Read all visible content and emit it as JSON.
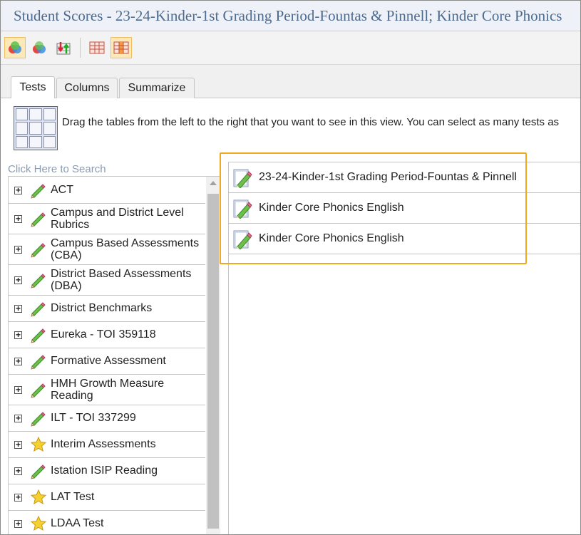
{
  "window": {
    "title": "Student Scores - 23-24-Kinder-1st Grading Period-Fountas & Pinnell; Kinder Core Phonics"
  },
  "toolbar": {
    "buttons": [
      "venn-icon",
      "venn-alt-icon",
      "sort-icon",
      "table-icon",
      "table-columns-icon"
    ]
  },
  "tabs": [
    {
      "label": "Tests",
      "active": true
    },
    {
      "label": "Columns",
      "active": false
    },
    {
      "label": "Summarize",
      "active": false
    }
  ],
  "instructions": "Drag the tables from the left to the right that you want to see in this view. You can select as many tests as",
  "search": {
    "placeholder": "Click Here to Search"
  },
  "tree": [
    {
      "label": "ACT",
      "icon": "pencil"
    },
    {
      "label": "Campus and District Level Rubrics",
      "icon": "pencil"
    },
    {
      "label": "Campus Based Assessments (CBA)",
      "icon": "pencil"
    },
    {
      "label": "District Based Assessments (DBA)",
      "icon": "pencil"
    },
    {
      "label": "District Benchmarks",
      "icon": "pencil"
    },
    {
      "label": "Eureka - TOI 359118",
      "icon": "pencil"
    },
    {
      "label": "Formative Assessment",
      "icon": "pencil"
    },
    {
      "label": "HMH Growth Measure Reading",
      "icon": "pencil"
    },
    {
      "label": "ILT - TOI 337299",
      "icon": "pencil"
    },
    {
      "label": "Interim Assessments",
      "icon": "star"
    },
    {
      "label": "Istation ISIP Reading",
      "icon": "pencil"
    },
    {
      "label": "LAT Test",
      "icon": "star"
    },
    {
      "label": "LDAA Test",
      "icon": "star"
    }
  ],
  "selected": [
    {
      "label": "23-24-Kinder-1st Grading Period-Fountas & Pinnell"
    },
    {
      "label": "Kinder Core Phonics English"
    },
    {
      "label": "Kinder Core Phonics English"
    }
  ],
  "colors": {
    "title": "#4d6b8f",
    "highlight": "#f0a81e",
    "search": "#8a9bb3"
  }
}
